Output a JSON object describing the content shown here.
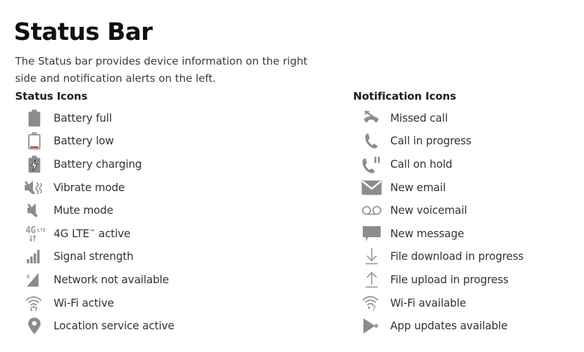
{
  "page": {
    "title": "Status Bar",
    "intro": "The Status bar provides device information on the right side and notification alerts on the left."
  },
  "colors": {
    "icon_gray": "#8c8c8c",
    "icon_gray_dark": "#7d7d7d",
    "text": "#333333",
    "heading": "#1c1c1c",
    "title": "#101010",
    "battery_low_accent": "#c0392b"
  },
  "columns": [
    {
      "id": "status-icons",
      "heading": "Status Icons",
      "items": [
        {
          "icon": "battery-full-icon",
          "label": "Battery full"
        },
        {
          "icon": "battery-low-icon",
          "label": "Battery low"
        },
        {
          "icon": "battery-charging-icon",
          "label": "Battery charging"
        },
        {
          "icon": "vibrate-mode-icon",
          "label": "Vibrate mode"
        },
        {
          "icon": "mute-mode-icon",
          "label": "Mute mode"
        },
        {
          "icon": "4g-lte-icon",
          "label": "4G LTE",
          "label_suffix": " active",
          "trademark": "™"
        },
        {
          "icon": "signal-strength-icon",
          "label": "Signal strength"
        },
        {
          "icon": "network-unavailable-icon",
          "label": "Network not available"
        },
        {
          "icon": "wifi-active-icon",
          "label": "Wi-Fi active"
        },
        {
          "icon": "location-pin-icon",
          "label": "Location service active"
        }
      ]
    },
    {
      "id": "notification-icons",
      "heading": "Notification Icons",
      "items": [
        {
          "icon": "missed-call-icon",
          "label": "Missed call"
        },
        {
          "icon": "call-in-progress-icon",
          "label": "Call in progress"
        },
        {
          "icon": "call-on-hold-icon",
          "label": "Call on hold"
        },
        {
          "icon": "new-email-icon",
          "label": "New email"
        },
        {
          "icon": "new-voicemail-icon",
          "label": "New voicemail"
        },
        {
          "icon": "new-message-icon",
          "label": "New message"
        },
        {
          "icon": "file-download-icon",
          "label": "File download in progress"
        },
        {
          "icon": "file-upload-icon",
          "label": "File upload in progress"
        },
        {
          "icon": "wifi-available-icon",
          "label": "Wi-Fi available"
        },
        {
          "icon": "app-updates-icon",
          "label": "App updates available"
        }
      ]
    }
  ]
}
